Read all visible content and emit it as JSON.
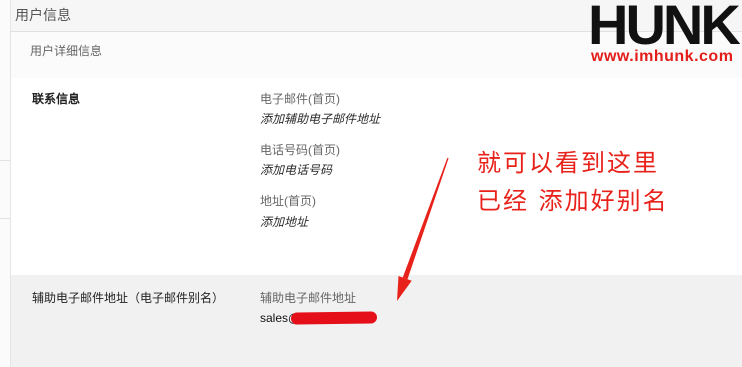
{
  "header": {
    "title": "用户信息"
  },
  "details": {
    "title": "用户详细信息"
  },
  "contact": {
    "section_label": "联系信息",
    "fields": [
      {
        "label": "电子邮件(首页)",
        "value": "添加辅助电子邮件地址"
      },
      {
        "label": "电话号码(首页)",
        "value": "添加电话号码"
      },
      {
        "label": "地址(首页)",
        "value": "添加地址"
      }
    ]
  },
  "alias": {
    "section_label": "辅助电子邮件地址（电子邮件别名）",
    "field_label": "辅助电子邮件地址",
    "value_prefix": "sales@"
  },
  "annotation": {
    "line1": "就可以看到这里",
    "line2": "已经 添加好别名"
  },
  "watermark": {
    "logo_text": "HUNK",
    "url": "www.imhunk.com"
  },
  "colors": {
    "annotation": "#e8221b",
    "url": "#e31d1a",
    "logo": "#111111",
    "alias_bg": "#f1f1f1"
  }
}
